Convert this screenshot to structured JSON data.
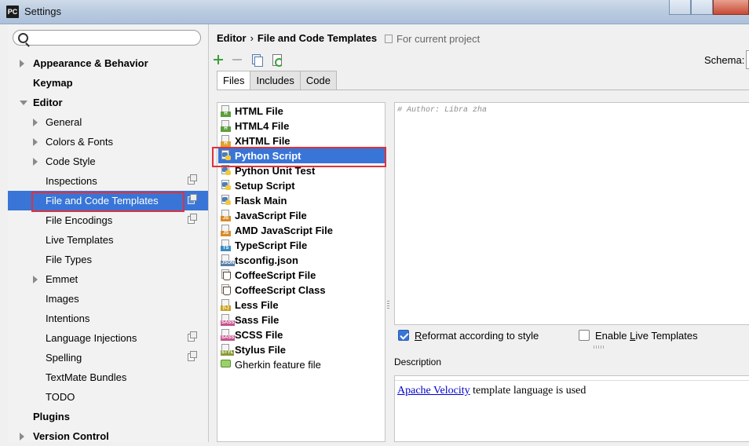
{
  "window": {
    "title": "Settings",
    "app_badge": "PC"
  },
  "search": {
    "placeholder": "",
    "value": ""
  },
  "sidebar": {
    "items": [
      {
        "label": "Appearance & Behavior"
      },
      {
        "label": "Keymap"
      },
      {
        "label": "Editor"
      },
      {
        "label": "General"
      },
      {
        "label": "Colors & Fonts"
      },
      {
        "label": "Code Style"
      },
      {
        "label": "Inspections"
      },
      {
        "label": "File and Code Templates"
      },
      {
        "label": "File Encodings"
      },
      {
        "label": "Live Templates"
      },
      {
        "label": "File Types"
      },
      {
        "label": "Emmet"
      },
      {
        "label": "Images"
      },
      {
        "label": "Intentions"
      },
      {
        "label": "Language Injections"
      },
      {
        "label": "Spelling"
      },
      {
        "label": "TextMate Bundles"
      },
      {
        "label": "TODO"
      },
      {
        "label": "Plugins"
      },
      {
        "label": "Version Control"
      }
    ],
    "selected": "File and Code Templates"
  },
  "header": {
    "breadcrumb_parent": "Editor",
    "breadcrumb_sep": "›",
    "breadcrumb_current": "File and Code Templates",
    "scope": "For current project"
  },
  "toolbar": {
    "schema_label": "Schema:"
  },
  "tabs": [
    {
      "label": "Files"
    },
    {
      "label": "Includes"
    },
    {
      "label": "Code"
    }
  ],
  "active_tab": "Files",
  "templates": [
    {
      "label": "HTML File",
      "icon": "html-file-icon",
      "tag": "H",
      "color": "#5c9e3b"
    },
    {
      "label": "HTML4 File",
      "icon": "html4-file-icon",
      "tag": "H",
      "color": "#5c9e3b"
    },
    {
      "label": "XHTML File",
      "icon": "xhtml-file-icon",
      "tag": "H",
      "color": "#e0a030"
    },
    {
      "label": "Python Script",
      "icon": "python-icon"
    },
    {
      "label": "Python Unit Test",
      "icon": "python-icon"
    },
    {
      "label": "Setup Script",
      "icon": "python-icon"
    },
    {
      "label": "Flask Main",
      "icon": "python-icon"
    },
    {
      "label": "JavaScript File",
      "icon": "javascript-file-icon",
      "tag": "JS",
      "color": "#d98a28"
    },
    {
      "label": "AMD JavaScript File",
      "icon": "javascript-file-icon",
      "tag": "JS",
      "color": "#d98a28"
    },
    {
      "label": "TypeScript File",
      "icon": "typescript-file-icon",
      "tag": "TS",
      "color": "#3a8ac2"
    },
    {
      "label": "tsconfig.json",
      "icon": "json-file-icon",
      "tag": "JSON",
      "color": "#5a7ea8"
    },
    {
      "label": "CoffeeScript File",
      "icon": "coffeescript-icon"
    },
    {
      "label": "CoffeeScript Class",
      "icon": "coffeescript-icon"
    },
    {
      "label": "Less File",
      "icon": "less-file-icon",
      "tag": "{L}",
      "color": "#c8a020"
    },
    {
      "label": "Sass File",
      "icon": "sass-file-icon",
      "tag": "SASS",
      "color": "#c6538c"
    },
    {
      "label": "SCSS File",
      "icon": "scss-file-icon",
      "tag": "SASS",
      "color": "#c6538c"
    },
    {
      "label": "Stylus File",
      "icon": "stylus-file-icon",
      "tag": "STYL",
      "color": "#8a9a3a"
    },
    {
      "label": "Gherkin feature file",
      "icon": "gherkin-icon"
    }
  ],
  "selected_template": "Python Script",
  "editor": {
    "content": "# Author: Libra zha"
  },
  "options": {
    "reformat": {
      "label_pre": "",
      "label_ul": "R",
      "label_post": "eformat according to style",
      "checked": true
    },
    "live_templates": {
      "label_pre": "Enable ",
      "label_ul": "L",
      "label_post": "ive Templates",
      "checked": false
    }
  },
  "description": {
    "label": "Description",
    "link": "Apache Velocity",
    "text": " template language is used"
  },
  "colors": {
    "selection": "#3875d7",
    "highlight_box": "#e0323a",
    "link": "#0000cc"
  }
}
